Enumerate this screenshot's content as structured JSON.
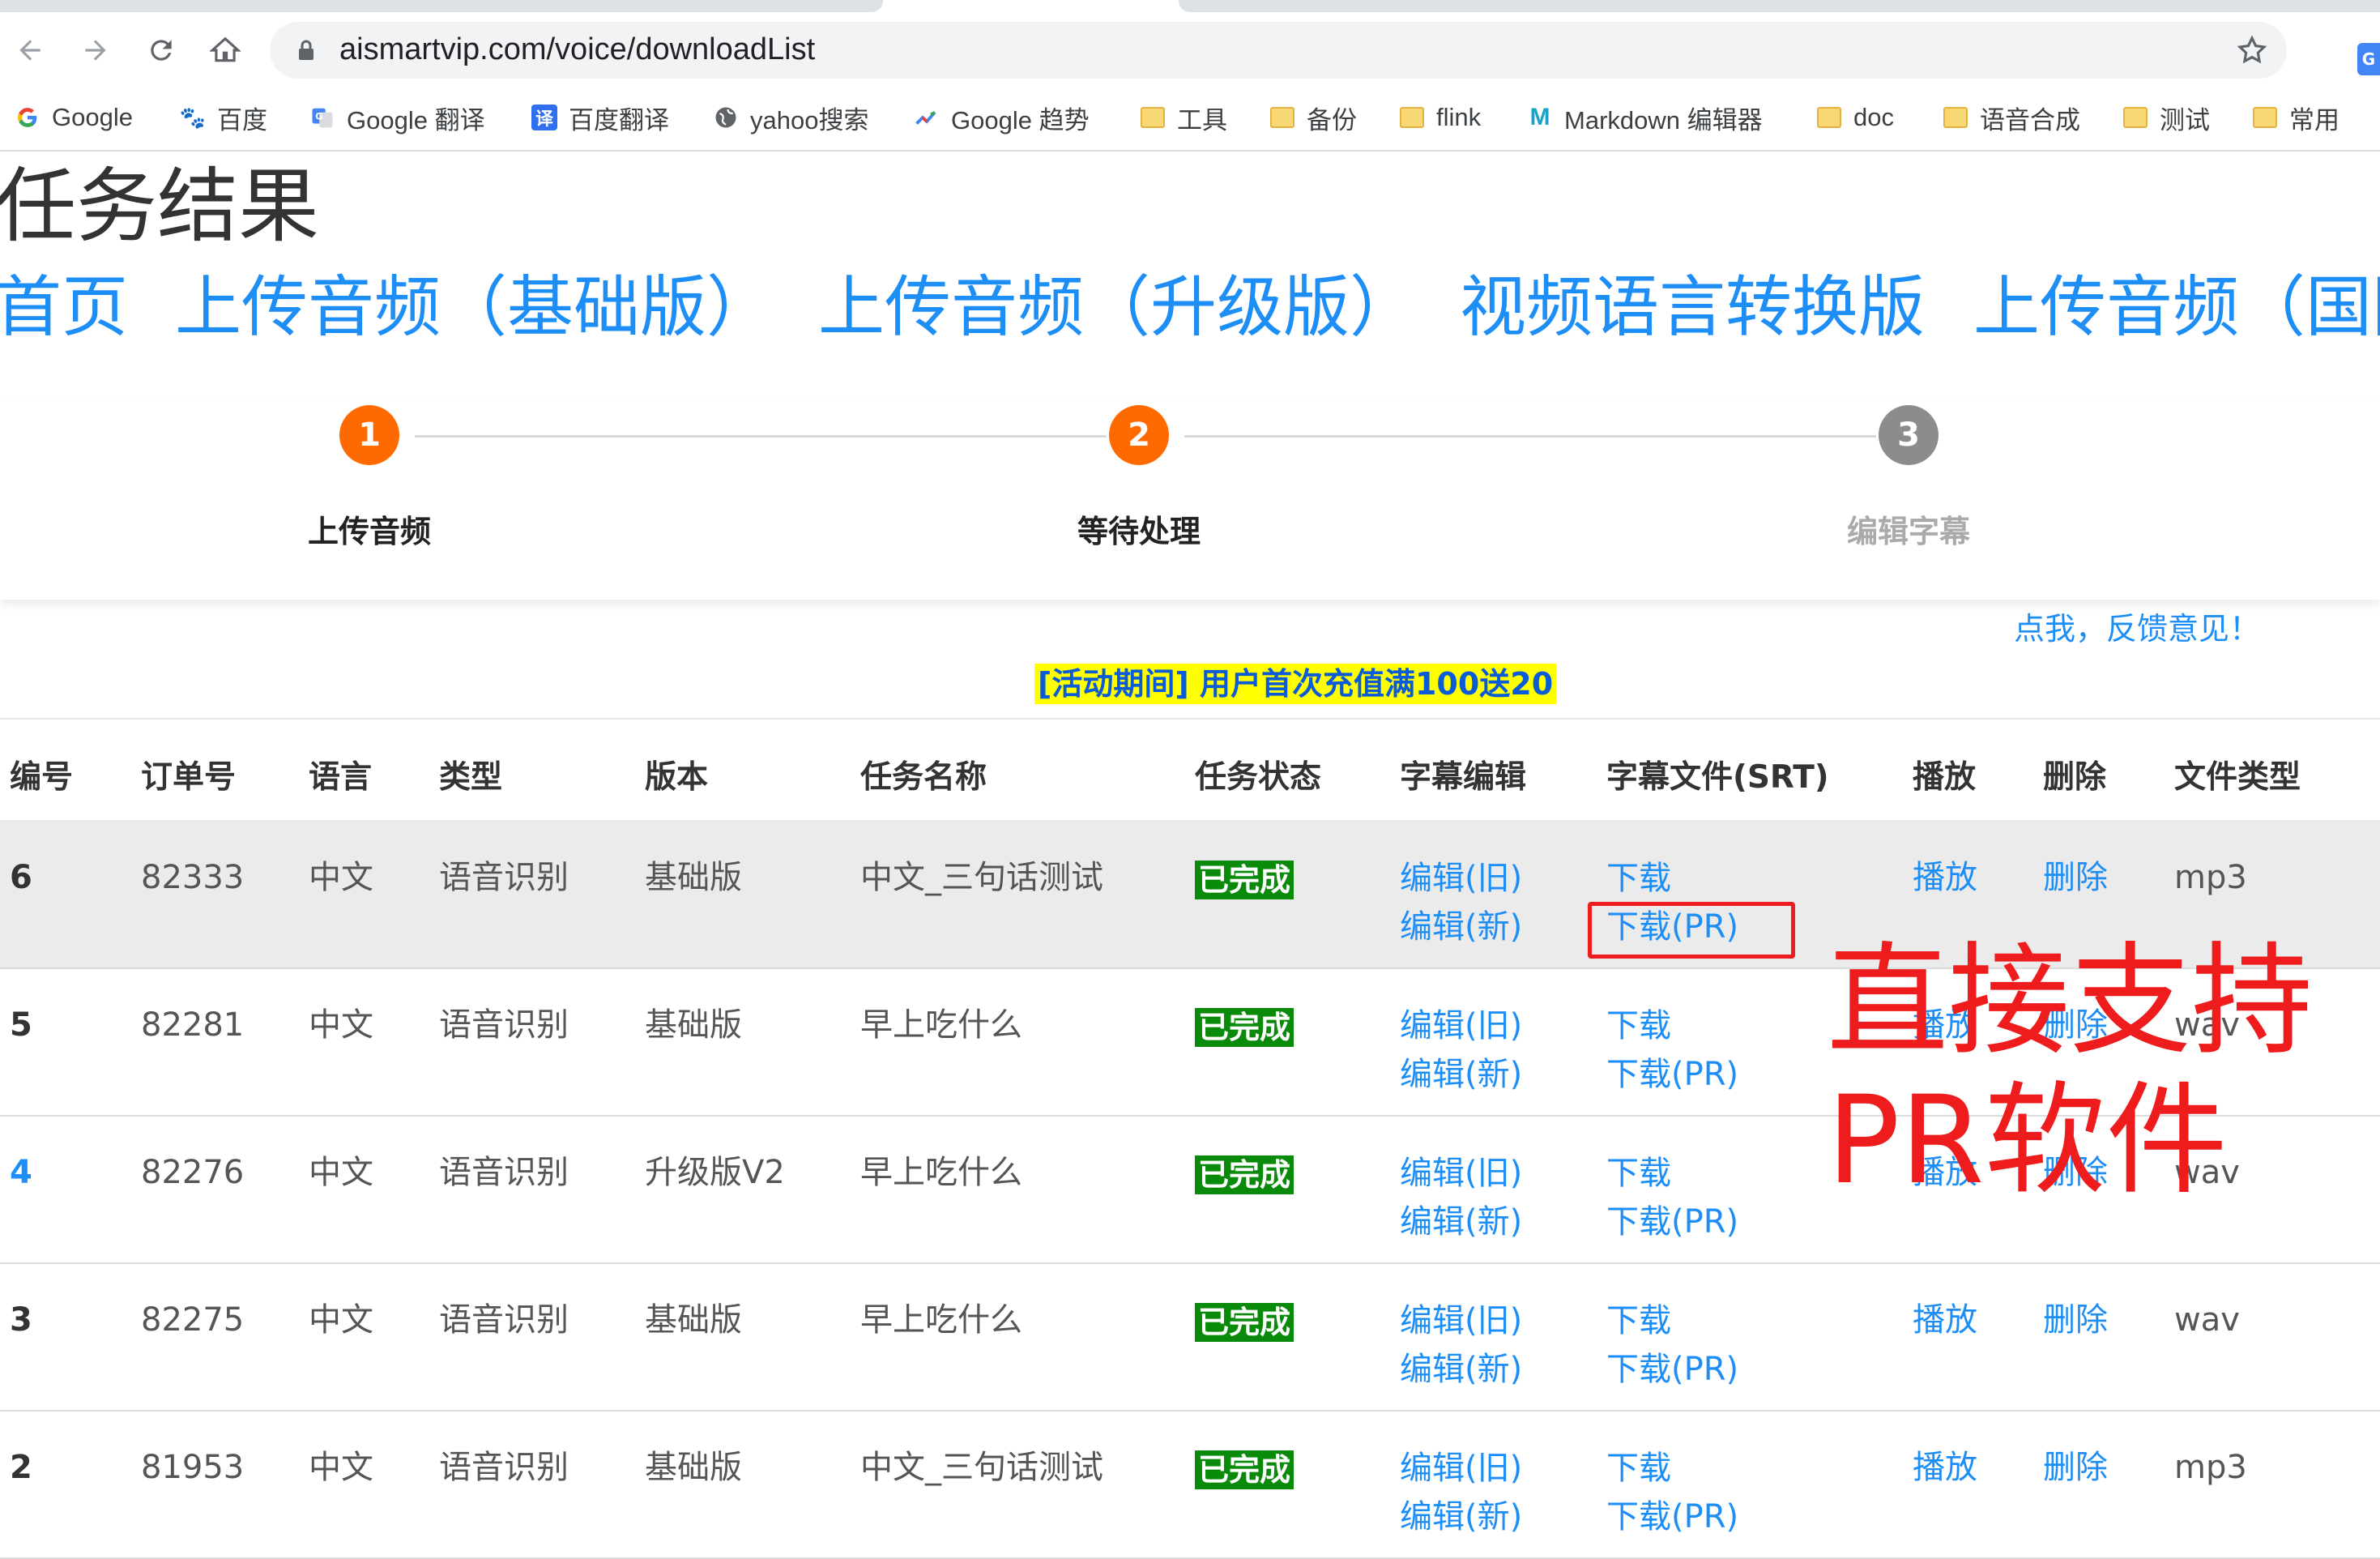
{
  "browser": {
    "url": "aismartvip.com/voice/downloadList",
    "bookmarks": [
      {
        "label": "Google",
        "icon": "google-icon"
      },
      {
        "label": "百度",
        "icon": "baidu-icon"
      },
      {
        "label": "Google 翻译",
        "icon": "google-translate-icon"
      },
      {
        "label": "百度翻译",
        "icon": "baidu-translate-icon"
      },
      {
        "label": "yahoo搜索",
        "icon": "globe-icon"
      },
      {
        "label": "Google 趋势",
        "icon": "trends-icon"
      },
      {
        "label": "工具",
        "icon": "folder-icon"
      },
      {
        "label": "备份",
        "icon": "folder-icon"
      },
      {
        "label": "flink",
        "icon": "folder-icon"
      },
      {
        "label": "Markdown 编辑器",
        "icon": "markdown-icon"
      },
      {
        "label": "doc",
        "icon": "folder-icon"
      },
      {
        "label": "语音合成",
        "icon": "folder-icon"
      },
      {
        "label": "测试",
        "icon": "folder-icon"
      },
      {
        "label": "常用",
        "icon": "folder-icon"
      }
    ]
  },
  "page": {
    "title": "任务结果",
    "nav": [
      "首页",
      "上传音频（基础版）",
      "上传音频（升级版）",
      "视频语言转换版",
      "上传音频（国际"
    ],
    "steps": [
      {
        "num": "1",
        "label": "上传音频",
        "color": "#ff6a00",
        "label_color": "#222222"
      },
      {
        "num": "2",
        "label": "等待处理",
        "color": "#ff6a00",
        "label_color": "#222222"
      },
      {
        "num": "3",
        "label": "编辑字幕",
        "color": "#8c8c8c",
        "label_color": "#aaaaaa"
      }
    ],
    "feedback": "点我，反馈意见！",
    "promo": "[活动期间]  用户首次充值满100送20"
  },
  "table": {
    "headers": [
      "编号",
      "订单号",
      "语言",
      "类型",
      "版本",
      "任务名称",
      "任务状态",
      "字幕编辑",
      "字幕文件(SRT)",
      "播放",
      "删除",
      "文件类型"
    ],
    "rows": [
      {
        "id": "6",
        "order": "82333",
        "lang": "中文",
        "type": "语音识别",
        "version": "基础版",
        "name": "中文_三句话测试",
        "status": "已完成",
        "edit_old": "编辑(旧)",
        "edit_new": "编辑(新)",
        "download": "下载",
        "download_pr": "下载(PR)",
        "play": "播放",
        "delete": "删除",
        "filetype": "mp3"
      },
      {
        "id": "5",
        "order": "82281",
        "lang": "中文",
        "type": "语音识别",
        "version": "基础版",
        "name": "早上吃什么",
        "status": "已完成",
        "edit_old": "编辑(旧)",
        "edit_new": "编辑(新)",
        "download": "下载",
        "download_pr": "下载(PR)",
        "play": "播放",
        "delete": "删除",
        "filetype": "wav"
      },
      {
        "id": "4",
        "order": "82276",
        "lang": "中文",
        "type": "语音识别",
        "version": "升级版V2",
        "name": "早上吃什么",
        "status": "已完成",
        "edit_old": "编辑(旧)",
        "edit_new": "编辑(新)",
        "download": "下载",
        "download_pr": "下载(PR)",
        "play": "播放",
        "delete": "删除",
        "filetype": "wav"
      },
      {
        "id": "3",
        "order": "82275",
        "lang": "中文",
        "type": "语音识别",
        "version": "基础版",
        "name": "早上吃什么",
        "status": "已完成",
        "edit_old": "编辑(旧)",
        "edit_new": "编辑(新)",
        "download": "下载",
        "download_pr": "下载(PR)",
        "play": "播放",
        "delete": "删除",
        "filetype": "wav"
      },
      {
        "id": "2",
        "order": "81953",
        "lang": "中文",
        "type": "语音识别",
        "version": "基础版",
        "name": "中文_三句话测试",
        "status": "已完成",
        "edit_old": "编辑(旧)",
        "edit_new": "编辑(新)",
        "download": "下载",
        "download_pr": "下载(PR)",
        "play": "播放",
        "delete": "删除",
        "filetype": "mp3"
      }
    ]
  },
  "annotation": {
    "text": "直接支持\nPR软件",
    "color": "#ee1c1c"
  }
}
